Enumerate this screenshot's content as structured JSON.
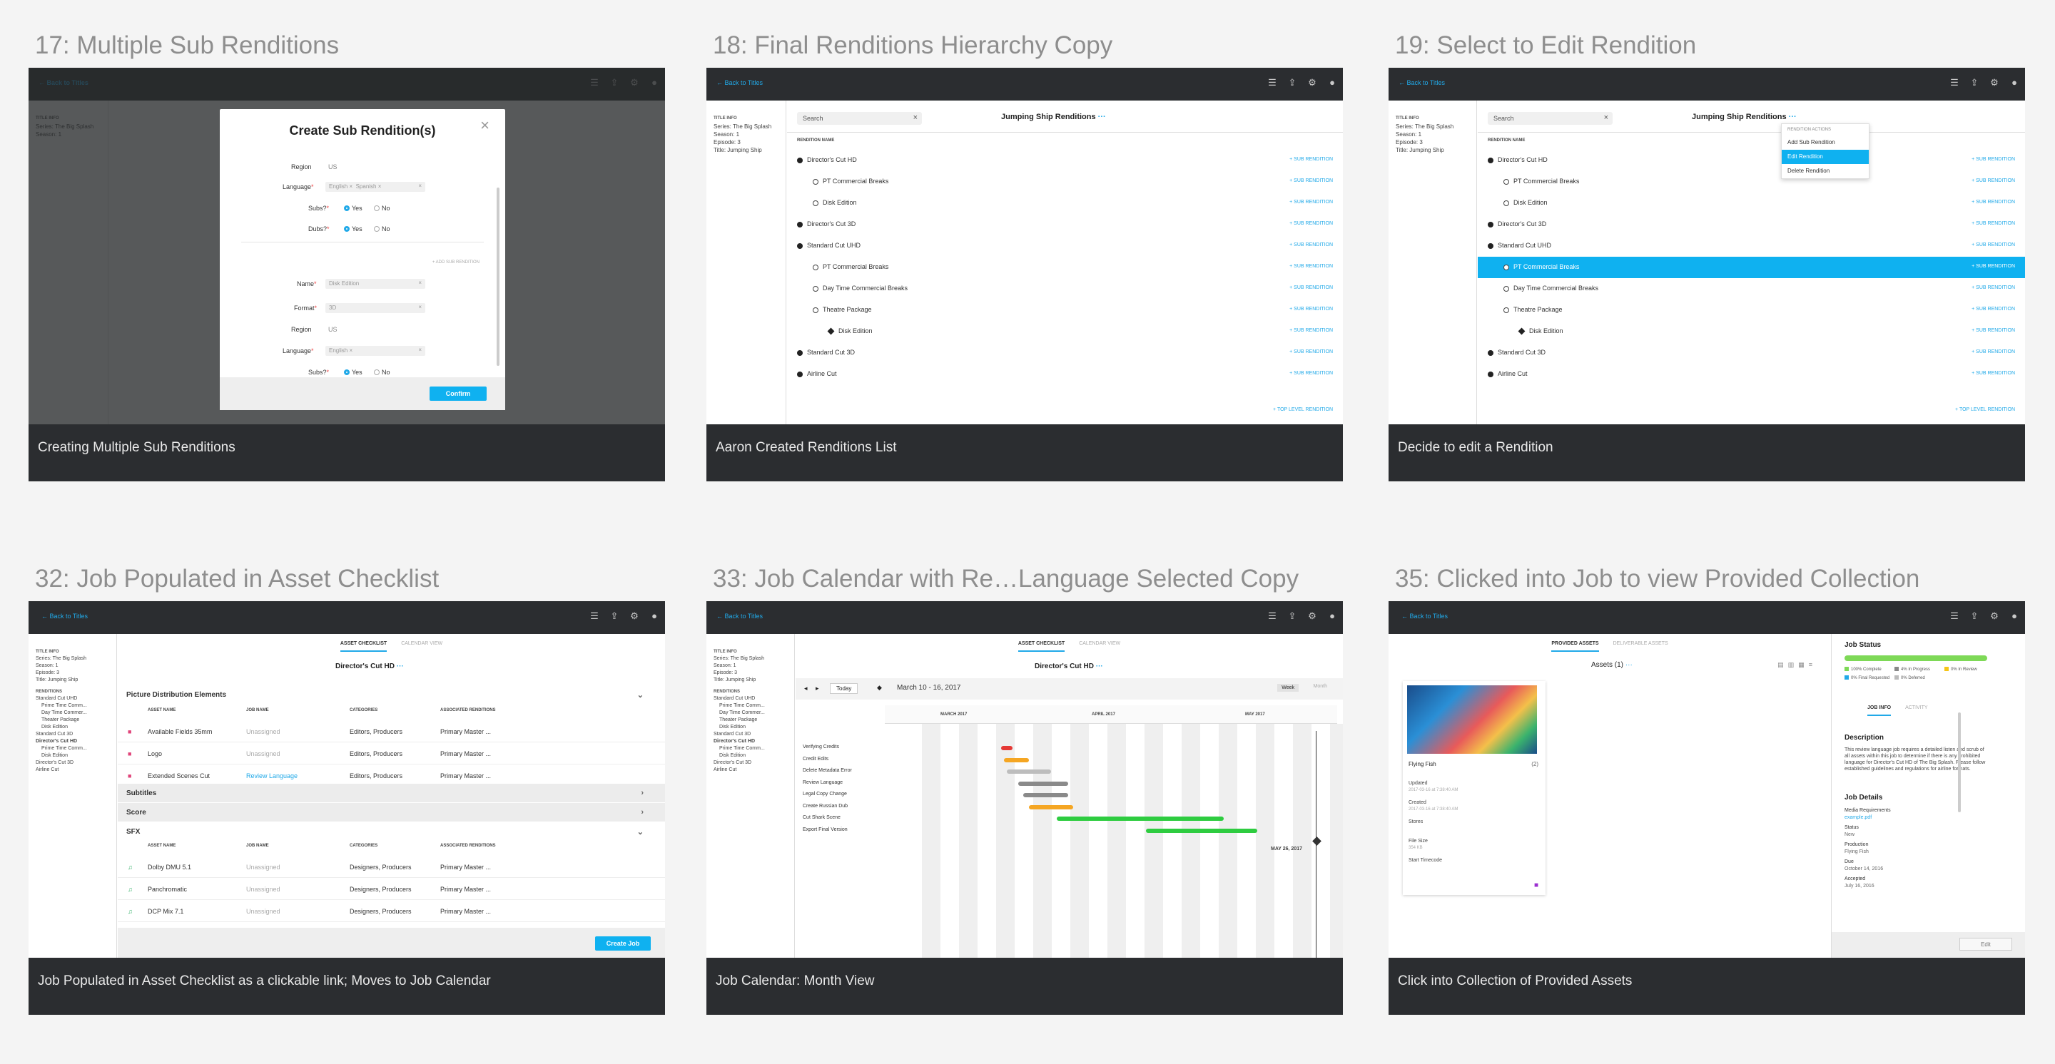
{
  "cards": [
    {
      "title": "17: Multiple Sub Renditions",
      "caption": "Creating Multiple Sub Renditions"
    },
    {
      "title": "18: Final Renditions Hierarchy Copy",
      "caption": "Aaron Created Renditions List"
    },
    {
      "title": "19: Select to Edit Rendition",
      "caption": "Decide to edit a Rendition"
    },
    {
      "title": "32: Job Populated in Asset Checklist",
      "caption": "Job Populated in Asset Checklist as a clickable link; Moves to Job Calendar"
    },
    {
      "title": "33: Job Calendar with Re…Language Selected Copy",
      "caption": "Job Calendar: Month View"
    },
    {
      "title": "35: Clicked into Job to view Provided Collection",
      "caption": "Click into Collection of Provided Assets"
    }
  ],
  "common": {
    "back_label": "Back to Titles",
    "back_arrow": "←",
    "icons": [
      "list-icon",
      "upload-icon",
      "gear-icon",
      "user-icon"
    ],
    "icon_glyphs": [
      "☰",
      "⇪",
      "⚙",
      "●"
    ],
    "title_info": "TITLE INFO",
    "series": "Series: The Big Splash",
    "season": "Season: 1",
    "episode": "Episode: 3",
    "title": "Title: Jumping Ship",
    "renditions_head": "RENDITIONS",
    "search_placeholder": "Search",
    "renditions_title": "Jumping Ship Renditions",
    "rendition_name_head": "RENDITION NAME",
    "sub_rendition": "+ SUB RENDITION",
    "top_level_rendition": "+ TOP LEVEL RENDITION",
    "more": "···"
  },
  "renditions": [
    {
      "name": "Director's Cut HD",
      "level": 0
    },
    {
      "name": "PT Commercial Breaks",
      "level": 1
    },
    {
      "name": "Disk Edition",
      "level": 1
    },
    {
      "name": "Director's Cut 3D",
      "level": 0
    },
    {
      "name": "Standard Cut UHD",
      "level": 0
    },
    {
      "name": "PT Commercial Breaks",
      "level": 1
    },
    {
      "name": "Day Time Commercial Breaks",
      "level": 1
    },
    {
      "name": "Theatre Package",
      "level": 1
    },
    {
      "name": "Disk Edition",
      "level": 2
    },
    {
      "name": "Standard Cut 3D",
      "level": 0
    },
    {
      "name": "Airline Cut",
      "level": 0
    }
  ],
  "modal": {
    "title": "Create Sub Rendition(s)",
    "close": "×",
    "region_label": "Region",
    "region_value": "US",
    "language_label": "Language",
    "language_chips": [
      "English",
      "Spanish"
    ],
    "subs_label": "Subs?",
    "dubs_label": "Dubs?",
    "yes": "Yes",
    "no": "No",
    "add_another": "+ ADD SUB RENDITION",
    "name_label": "Name",
    "name_value": "Disk Edition",
    "format_label": "Format",
    "format_value": "3D",
    "region2_value": "US",
    "language2_chip": "English",
    "confirm": "Confirm"
  },
  "menu": {
    "header": "RENDITION ACTIONS",
    "items": [
      "Add Sub Rendition",
      "Edit Rendition",
      "Delete Rendition"
    ]
  },
  "checklist": {
    "tab_active": "ASSET CHECKLIST",
    "tab_other": "CALENDAR VIEW",
    "heading": "Director's Cut HD",
    "side_renditions": [
      "Standard Cut UHD",
      "Prime Time Comm...",
      "Day Time Commer...",
      "Theater Package",
      "Disk Edition",
      "Standard Cut 3D",
      "Director's Cut HD",
      "Prime Time Comm...",
      "Disk Edition",
      "Director's Cut 3D",
      "Airline Cut"
    ],
    "section1": "Picture Distribution Elements",
    "cols": [
      "ASSET NAME",
      "JOB NAME",
      "CATEGORIES",
      "ASSOCIATED RENDITIONS"
    ],
    "rows1": [
      {
        "asset": "Available Fields 35mm",
        "job": "Unassigned",
        "cat": "Editors, Producers",
        "rend": "Primary Master ..."
      },
      {
        "asset": "Logo",
        "job": "Unassigned",
        "cat": "Editors, Producers",
        "rend": "Primary Master ..."
      },
      {
        "asset": "Extended Scenes Cut",
        "job": "Review Language",
        "cat": "Editors, Producers",
        "rend": "Primary Master ..."
      }
    ],
    "section2": "Subtitles",
    "section3": "Score",
    "section4": "SFX",
    "rows2": [
      {
        "asset": "Dolby DMU 5.1",
        "job": "Unassigned",
        "cat": "Designers, Producers",
        "rend": "Primary Master ..."
      },
      {
        "asset": "Panchromatic",
        "job": "Unassigned",
        "cat": "Designers, Producers",
        "rend": "Primary Master ..."
      },
      {
        "asset": "DCP Mix 7.1",
        "job": "Unassigned",
        "cat": "Designers, Producers",
        "rend": "Primary Master ..."
      }
    ],
    "create_job": "Create Job"
  },
  "calendar": {
    "today": "Today",
    "range": "March 10 - 16, 2017",
    "week": "Week",
    "month": "Month",
    "months": [
      "MARCH 2017",
      "APRIL 2017",
      "MAY 2017"
    ],
    "tasks": [
      "Verifying Credits",
      "Credit Edits",
      "Delete Metadata Error",
      "Review Language",
      "Legal Copy Change",
      "Create Russian Dub",
      "Cut Shark Scene",
      "Export Final Version"
    ],
    "deadline": "MAY 26, 2017"
  },
  "collection": {
    "tab_active": "PROVIDED ASSETS",
    "tab_other": "DELIVERABLE ASSETS",
    "assets_title": "Assets (1)",
    "asset_name": "Flying Fish",
    "asset_count": "(2)",
    "meta": [
      {
        "k": "Updated",
        "v": "2017-03-16 at 7:38:40 AM"
      },
      {
        "k": "Created",
        "v": "2017-03-16 at 7:38:40 AM"
      },
      {
        "k": "Stores",
        "v": ""
      },
      {
        "k": "File Size",
        "v": "354 KB"
      },
      {
        "k": "Start Timecode",
        "v": ""
      }
    ],
    "job_status": "Job Status",
    "legend": [
      "100% Complete",
      "4% In Progress",
      "0% In Review",
      "0% Final Requested",
      "0% Deferred"
    ],
    "tab_job": "JOB INFO",
    "tab_activity": "ACTIVITY",
    "desc_head": "Description",
    "desc": "This review language job requires a detailed listen and scrub of all assets within this job to determine if there is any prohibited language for Director's Cut HD of The Big Splash. Please follow established guidelines and regulations for airline formats.",
    "details_head": "Job Details",
    "details": [
      {
        "k": "Media Requirements",
        "v": "example.pdf"
      },
      {
        "k": "Status",
        "v": "New"
      },
      {
        "k": "Production",
        "v": "Flying Fish"
      },
      {
        "k": "Due",
        "v": "October 14, 2016"
      },
      {
        "k": "Accepted",
        "v": "July 16, 2016"
      }
    ],
    "edit": "Edit"
  }
}
